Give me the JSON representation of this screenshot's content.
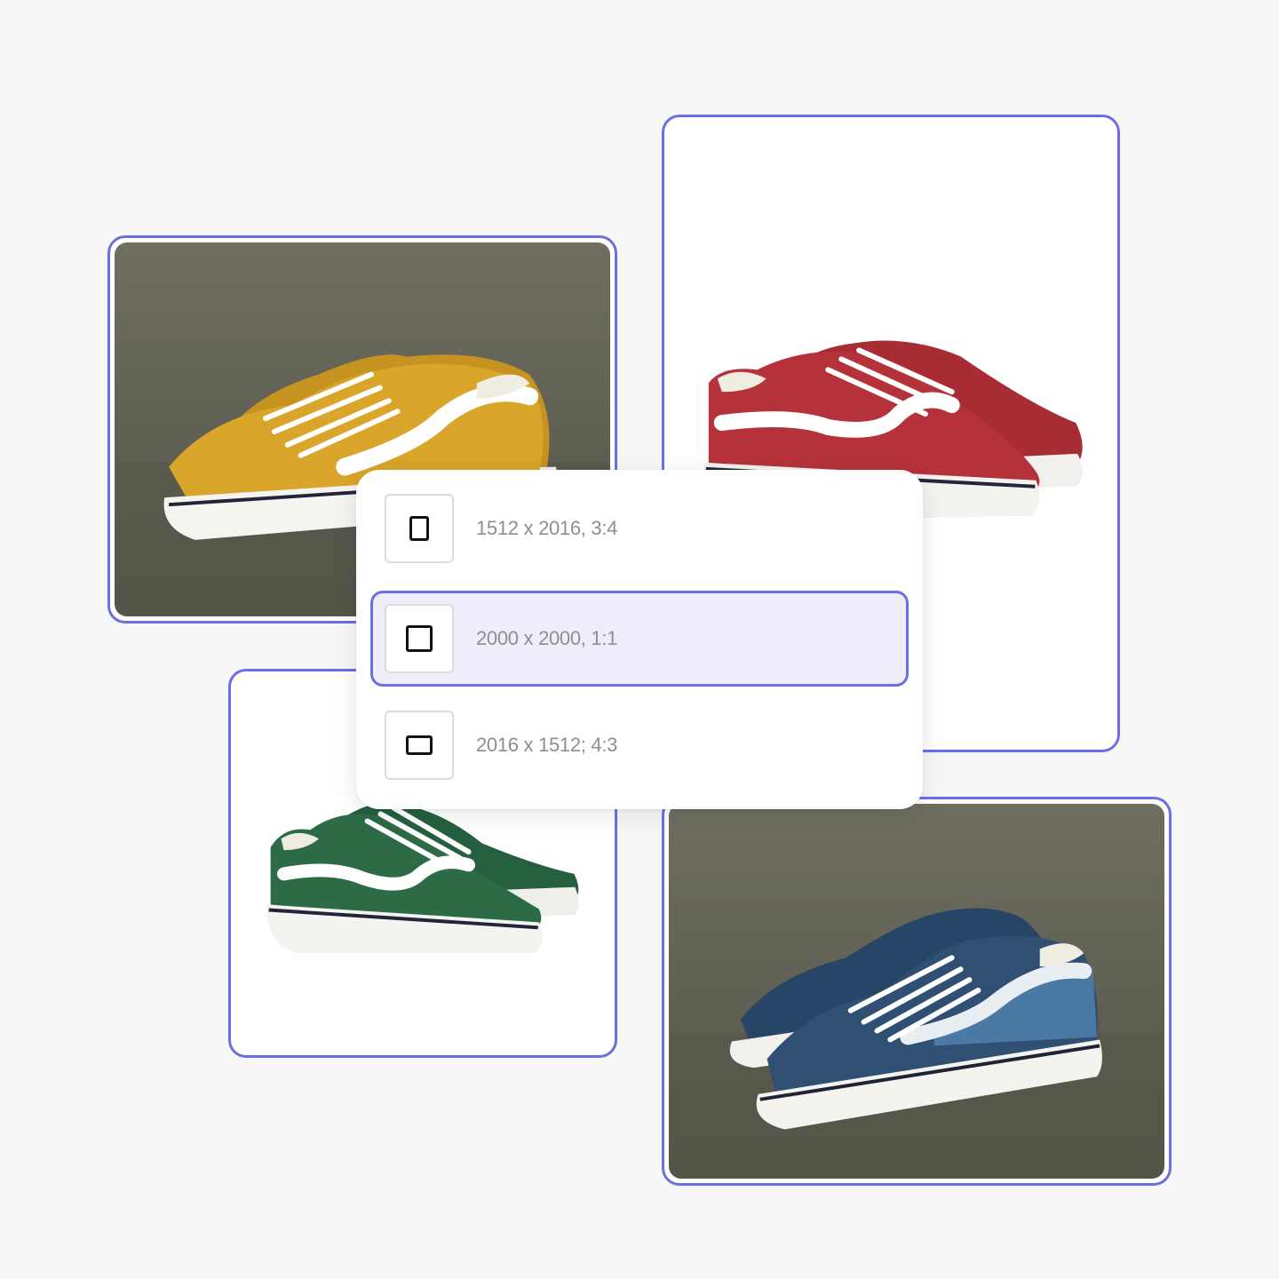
{
  "aspect_menu": {
    "options": [
      {
        "label": "1512 x 2016, 3:4",
        "icon": "portrait-frame-icon",
        "selected": false
      },
      {
        "label": "2000 x 2000, 1:1",
        "icon": "square-frame-icon",
        "selected": true
      },
      {
        "label": "2016 x 1512; 4:3",
        "icon": "landscape-frame-icon",
        "selected": false
      }
    ]
  },
  "colors": {
    "accent": "#6b6fe6",
    "selected_bg": "#eeeefb",
    "page_bg": "#f7f7f8",
    "label_text": "#8e8e93"
  },
  "images": [
    {
      "name": "yellow-sneakers",
      "background": "studio",
      "shoe_color": "#d9a52a"
    },
    {
      "name": "red-sneakers",
      "background": "white",
      "shoe_color": "#b5323a"
    },
    {
      "name": "green-sneakers",
      "background": "white",
      "shoe_color": "#2c6b45"
    },
    {
      "name": "blue-sneakers",
      "background": "studio",
      "shoe_color": "#2f4f73"
    }
  ]
}
